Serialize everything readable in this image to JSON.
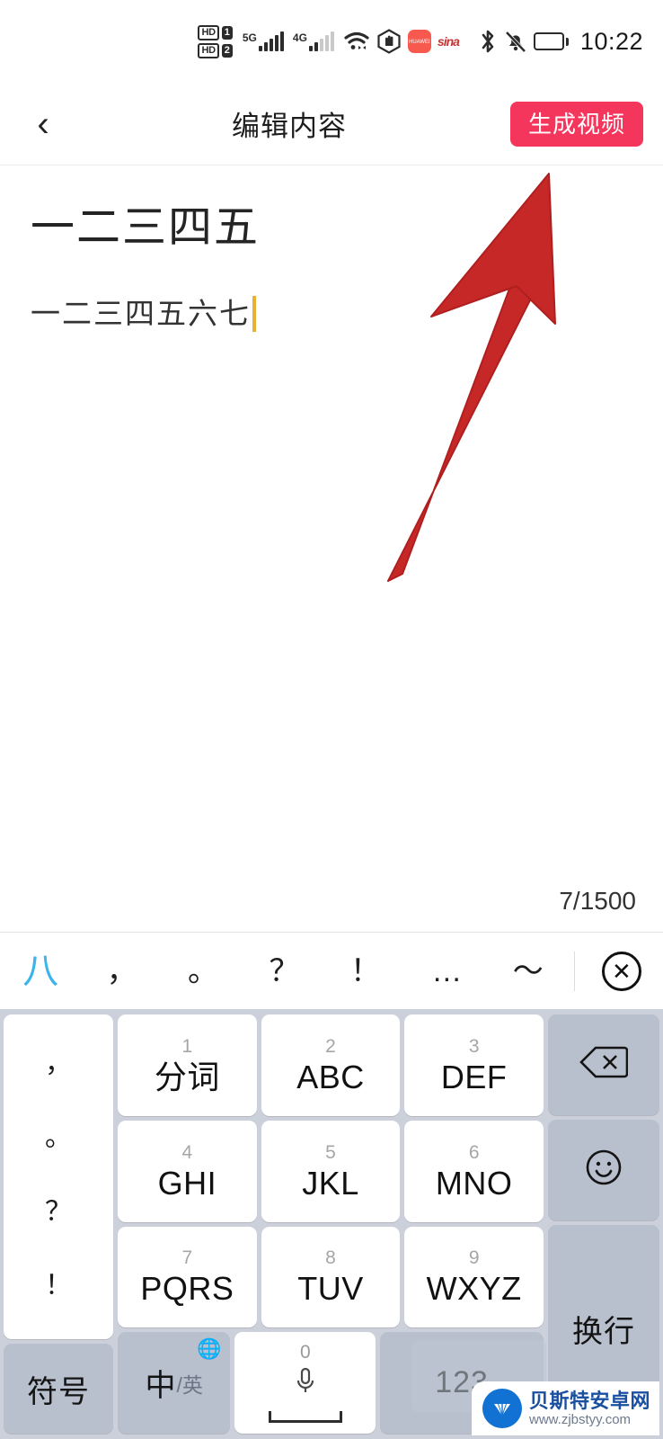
{
  "status_bar": {
    "hd1_label": "HD",
    "sim1_label": "1",
    "hd2_label": "HD",
    "sim2_label": "2",
    "network_primary": "5G",
    "network_secondary": "4G",
    "wifi_icon": "wifi-icon",
    "do_not_disturb_icon": "hand-stop-icon",
    "huawei_icon_label": "HUAWEI",
    "sina_icon_label": "sina",
    "bluetooth_icon": "bluetooth-icon",
    "mute_icon": "bell-mute-icon",
    "battery_icon": "battery-icon",
    "time": "10:22"
  },
  "header": {
    "back_icon": "chevron-left-icon",
    "title": "编辑内容",
    "action_button": "生成视频",
    "action_color": "#f5365c"
  },
  "editor": {
    "doc_title": "一二三四五",
    "doc_body": "一二三四五六七",
    "caret_color": "#e8b130",
    "counter": "7/1500"
  },
  "annotation": {
    "type": "arrow",
    "color": "#c62828",
    "points_to": "生成视频"
  },
  "candidate_bar": {
    "candidates": [
      "八",
      "，",
      "。",
      "？",
      "！",
      "…",
      "～"
    ],
    "close_icon": "close-circle-icon"
  },
  "keyboard": {
    "punctuation_column": [
      "，",
      "。",
      "？",
      "！"
    ],
    "rows": [
      [
        {
          "num": "1",
          "label": "分词"
        },
        {
          "num": "2",
          "label": "ABC"
        },
        {
          "num": "3",
          "label": "DEF"
        }
      ],
      [
        {
          "num": "4",
          "label": "GHI"
        },
        {
          "num": "5",
          "label": "JKL"
        },
        {
          "num": "6",
          "label": "MNO"
        }
      ],
      [
        {
          "num": "7",
          "label": "PQRS"
        },
        {
          "num": "8",
          "label": "TUV"
        },
        {
          "num": "9",
          "label": "WXYZ"
        }
      ]
    ],
    "right_column": [
      {
        "name": "backspace",
        "glyph": "⌫"
      },
      {
        "name": "emoji",
        "glyph": "☺"
      },
      {
        "name": "newline",
        "label": "换行"
      }
    ],
    "bottom_row": {
      "symbol_key": "符号",
      "lang_key_main": "中",
      "lang_key_sub": "/英",
      "globe_icon": "globe-icon",
      "space_zero": "0",
      "mic_icon": "microphone-icon",
      "number_key": "123"
    }
  },
  "watermark": {
    "site_name": "贝斯特安卓网",
    "url": "www.zjbstyy.com"
  }
}
